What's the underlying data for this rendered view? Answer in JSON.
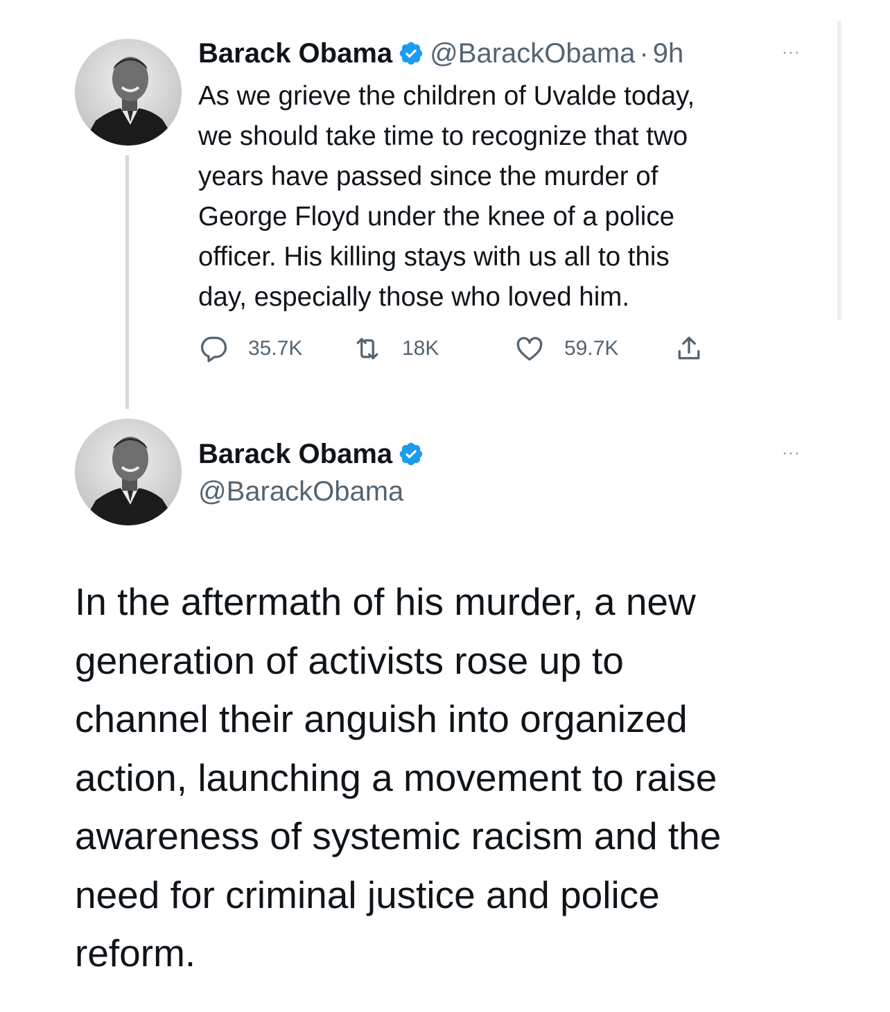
{
  "tweet1": {
    "author": {
      "name": "Barack Obama",
      "handle": "@BarackObama",
      "separator": "·",
      "time": "9h"
    },
    "more_label": "···",
    "lines": [
      "As we grieve the children of Uvalde today,",
      "we should take time to recognize that two",
      "years have passed since the murder of",
      "George Floyd under the knee of a police",
      "officer. His killing stays with us all to this",
      "day, especially those who loved him."
    ],
    "actions": {
      "reply_count": "35.7K",
      "retweet_count": "18K",
      "like_count": "59.7K"
    }
  },
  "tweet2": {
    "author": {
      "name": "Barack Obama",
      "handle": "@BarackObama"
    },
    "more_label": "···",
    "lines": [
      "In the aftermath of his murder, a new",
      "generation of activists rose up to",
      "channel their anguish into organized",
      "action, launching a movement to raise",
      "awareness of systemic racism and the",
      "need for criminal justice and police",
      "reform."
    ]
  },
  "colors": {
    "text": "#0f1419",
    "secondary": "#536471",
    "verified": "#1d9bf0",
    "thread_line": "#cfd9de"
  },
  "icons": {
    "reply": "reply-icon",
    "retweet": "retweet-icon",
    "like": "like-icon",
    "share": "share-icon",
    "verified": "verified-badge-icon"
  }
}
